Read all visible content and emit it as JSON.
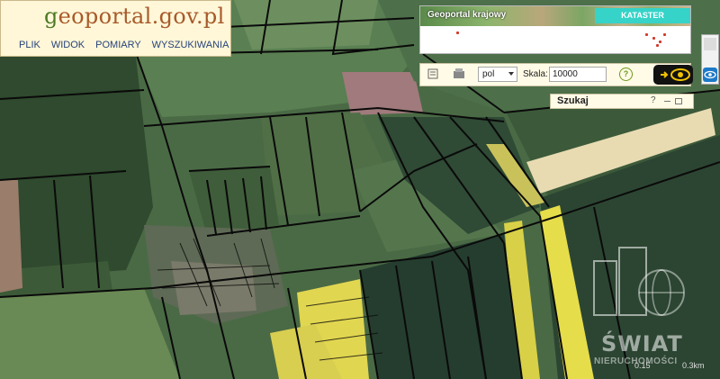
{
  "app": {
    "logo_prefix": "g",
    "logo_rest": "eoportal.gov.pl"
  },
  "menu": [
    {
      "label": "PLIK"
    },
    {
      "label": "WIDOK"
    },
    {
      "label": "POMIARY"
    },
    {
      "label": "WYSZUKIWANIA"
    }
  ],
  "banner": {
    "title": "Geoportal krajowy",
    "tab_label": "KATASTER"
  },
  "toolbar": {
    "language": "pol",
    "scale_label": "Skala:",
    "scale_value": "10000",
    "help_label": "?"
  },
  "search": {
    "title": "Szukaj",
    "help": "?"
  },
  "scalebar": {
    "mid": "0.15",
    "right": "0.3km"
  },
  "watermark": {
    "title": "ŚWIAT",
    "subtitle": "NIERUCHOMOŚCI"
  },
  "colors": {
    "brand_green": "#4d7a25",
    "brand_brown": "#a85a2a",
    "menu_blue": "#26437a",
    "tab_cyan": "#35d3c8",
    "help_green": "#6e9a1d"
  },
  "icons": [
    "print-icon",
    "map-layers-icon",
    "help-icon",
    "eye-icon",
    "arrow-right-icon",
    "minimize-icon",
    "maximize-icon"
  ]
}
